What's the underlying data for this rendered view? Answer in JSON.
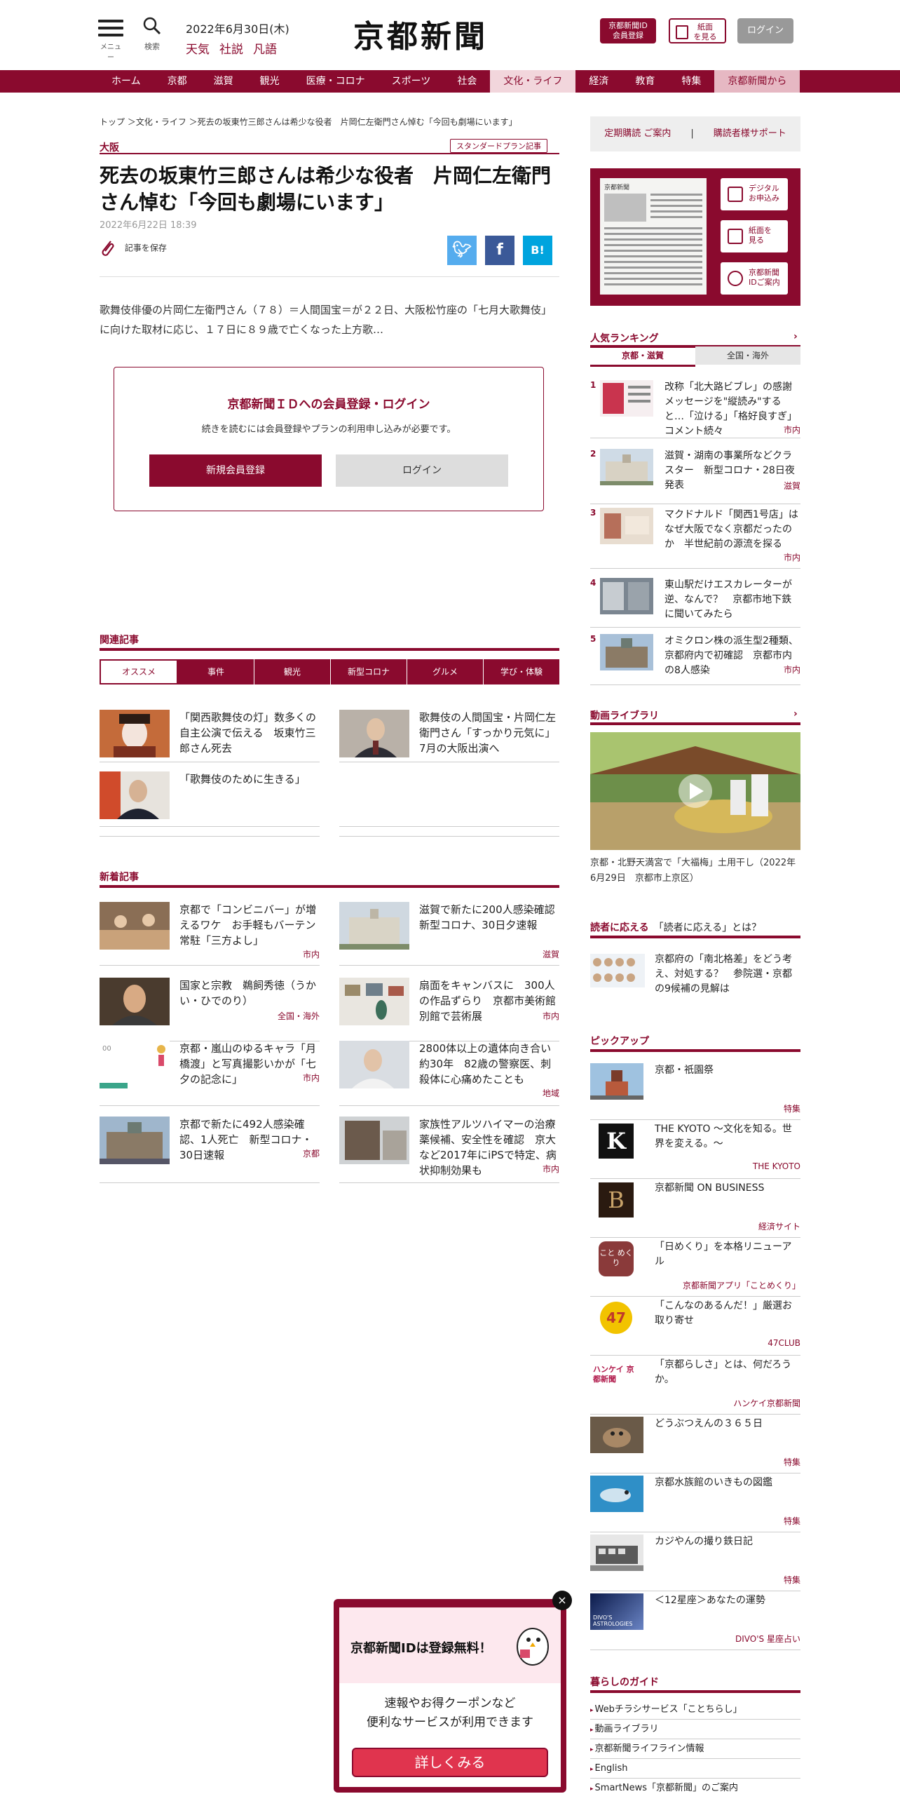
{
  "header": {
    "menu_label": "メニュー",
    "search_label": "検索",
    "date": "2022年6月30日(木)",
    "links": [
      "天気",
      "社説",
      "凡語"
    ],
    "logo": "京都新聞",
    "register_btn": [
      "京都新聞ID",
      "会員登録"
    ],
    "paper_btn": [
      "紙面",
      "を見る"
    ],
    "login_btn": "ログイン"
  },
  "nav": [
    "ホーム",
    "京都",
    "滋賀",
    "観光",
    "医療・コロナ",
    "スポーツ",
    "社会",
    "文化・ライフ",
    "経済",
    "教育",
    "特集",
    "京都新聞から"
  ],
  "article": {
    "breadcrumb": "トップ ＞文化・ライフ ＞死去の坂東竹三郎さんは希少な役者　片岡仁左衛門さん悼む「今回も劇場にいます」",
    "region": "大阪",
    "plan_badge": "スタンダードプラン記事",
    "title": "死去の坂東竹三郎さんは希少な役者　片岡仁左衛門さん悼む「今回も劇場にいます」",
    "date": "2022年6月22日 18:39",
    "save_label": "記事を保存",
    "share": {
      "twitter": "t",
      "facebook": "f",
      "hatena": "B!"
    },
    "lead": "歌舞伎俳優の片岡仁左衛門さん（７８）＝人間国宝＝が２２日、大阪松竹座の「七月大歌舞伎」に向けた取材に応じ、１７日に８９歳で亡くなった上方歌…"
  },
  "login_box": {
    "title": "京都新聞ＩＤへの会員登録・ログイン",
    "sub": "続きを読むには会員登録やプランの利用申し込みが必要です。",
    "register": "新規会員登録",
    "login": "ログイン"
  },
  "related": {
    "heading": "関連記事",
    "tabs": [
      "オススメ",
      "事件",
      "観光",
      "新型コロナ",
      "グルメ",
      "学び・体験"
    ],
    "items": [
      {
        "title": "「関西歌舞伎の灯」数多くの自主公演で伝える　坂東竹三郎さん死去"
      },
      {
        "title": "歌舞伎の人間国宝・片岡仁左衛門さん「すっかり元気に」　7月の大阪出演へ"
      },
      {
        "title": "「歌舞伎のために生きる」"
      }
    ]
  },
  "latest": {
    "heading": "新着記事",
    "items": [
      {
        "title": "京都で「コンビニバー」が増えるワケ　お手軽もバーテン常駐「三方よし」",
        "cat": "市内"
      },
      {
        "title": "滋賀で新たに200人感染確認　新型コロナ、30日夕速報",
        "cat": "滋賀"
      },
      {
        "title": "国家と宗教　鵜飼秀徳（うかい・ひでのり）",
        "cat": "全国・海外"
      },
      {
        "title": "扇面をキャンバスに　300人の作品ずらり　京都市美術館別館で芸術展",
        "cat": "市内"
      },
      {
        "title": "京都・嵐山のゆるキャラ「月橋渡」と写真撮影いかが「七夕の記念に」",
        "cat": "市内"
      },
      {
        "title": "2800体以上の遺体向き合い約30年　82歳の警察医、刺殺体に心痛めたことも",
        "cat": "地域"
      },
      {
        "title": "京都で新たに492人感染確認、1人死亡　新型コロナ・30日速報",
        "cat": "京都"
      },
      {
        "title": "家族性アルツハイマーの治療薬候補、安全性を確認　京大など2017年にiPSで特定、病状抑制効果も",
        "cat": "市内"
      }
    ]
  },
  "sidebar": {
    "sub_links": [
      "定期購読 ご案内",
      "|",
      "購読者様サポート"
    ],
    "paper_buttons": [
      [
        "デジタル",
        "お申込み"
      ],
      [
        "紙面を",
        "見る"
      ],
      [
        "京都新聞",
        "IDご案内"
      ]
    ],
    "paper_np_title": "京都新聞",
    "ranking": {
      "heading": "人気ランキング",
      "chevron": "›",
      "tabs": [
        "京都・滋賀",
        "全国・海外"
      ],
      "items": [
        {
          "num": "1",
          "title": "改称「北大路ビブレ」の感謝メッセージを\"縦読み\"すると…「泣ける」「格好良すぎ」コメント続々",
          "cat": "市内"
        },
        {
          "num": "2",
          "title": "滋賀・湖南の事業所などクラスター　新型コロナ・28日夜発表",
          "cat": "滋賀"
        },
        {
          "num": "3",
          "title": "マクドナルド「関西1号店」はなぜ大阪でなく京都だったのか　半世紀前の源流を探る",
          "cat": "市内"
        },
        {
          "num": "4",
          "title": "東山駅だけエスカレーターが逆、なんで？　京都市地下鉄に聞いてみたら",
          "cat": ""
        },
        {
          "num": "5",
          "title": "オミクロン株の派生型2種類、京都府内で初確認　京都市内の8人感染",
          "cat": "市内"
        }
      ]
    },
    "video": {
      "heading": "動画ライブラリ",
      "chevron": "›",
      "caption": "京都・北野天満宮で「大福梅」土用干し（2022年6月29日　京都市上京区）"
    },
    "readers": {
      "head_bold": "読者に応える",
      "head_rest": "「読者に応える」とは？",
      "item": "京都府の「南北格差」をどう考え、対処する？　参院選・京都の9候補の見解は"
    },
    "pickup": {
      "heading": "ピックアップ",
      "items": [
        {
          "title": "京都・祇園祭",
          "cat": "特集"
        },
        {
          "title": "THE KYOTO ～文化を知る。世界を変える。～",
          "cat": "THE KYOTO",
          "logo": "K"
        },
        {
          "title": "京都新聞 ON BUSINESS",
          "cat": "経済サイト",
          "logo": "B"
        },
        {
          "title": "「日めくり」を本格リニューアル",
          "cat": "京都新聞アプリ「ことめくり」",
          "logo": "こと めくり"
        },
        {
          "title": "「こんなのあるんだ！」厳選お取り寄せ",
          "cat": "47CLUB",
          "logo": "47"
        },
        {
          "title": "「京都らしさ」とは、何だろうか。",
          "cat": "ハンケイ京都新聞",
          "logo": "ハンケイ 京都新聞"
        },
        {
          "title": "どうぶつえんの３６５日",
          "cat": "特集"
        },
        {
          "title": "京都水族館のいきもの図鑑",
          "cat": "特集"
        },
        {
          "title": "カジやんの撮り鉄日記",
          "cat": "特集"
        },
        {
          "title": "＜12星座＞あなたの運勢",
          "cat": "DIVO'S 星座占い",
          "logo": "DIVO'S ASTROLOGIES"
        }
      ]
    },
    "guide": {
      "heading": "暮らしのガイド",
      "items": [
        "Webチラシサービス「ことちらし」",
        "動画ライブラリ",
        "京都新聞ライフライン情報",
        "English",
        "SmartNews「京都新聞」のご案内"
      ]
    }
  },
  "popup": {
    "title": "京都新聞IDは登録無料！",
    "desc1": "速報やお得クーポンなど",
    "desc2": "便利なサービスが利用できます",
    "button": "詳しくみる",
    "close": "×"
  }
}
